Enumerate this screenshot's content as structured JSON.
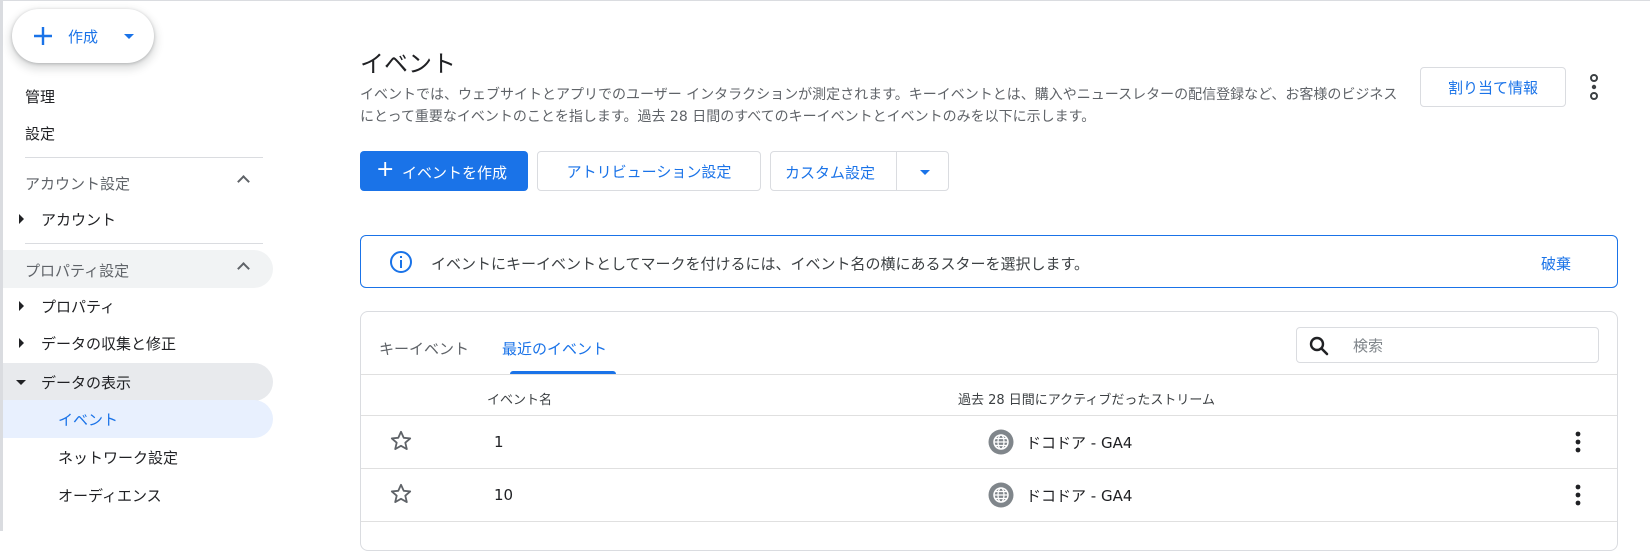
{
  "sidebar": {
    "create_label": "作成",
    "items": {
      "admin": "管理",
      "settings": "設定"
    },
    "account_section": "アカウント設定",
    "account_item": "アカウント",
    "property_section": "プロパティ設定",
    "property_item": "プロパティ",
    "data_collection": "データの収集と修正",
    "data_display": "データの表示",
    "events": "イベント",
    "network": "ネットワーク設定",
    "audience": "オーディエンス"
  },
  "page": {
    "title": "イベント",
    "description": "イベントでは、ウェブサイトとアプリでのユーザー インタラクションが測定されます。キーイベントとは、購入やニュースレターの配信登録など、お客様のビジネスにとって重要なイベントのことを指します。過去 28 日間のすべてのキーイベントとイベントのみを以下に示します。",
    "assign_button": "割り当て情報",
    "create_event_button": "イベントを作成",
    "attribution_button": "アトリビューション設定",
    "custom_button": "カスタム設定"
  },
  "banner": {
    "text": "イベントにキーイベントとしてマークを付けるには、イベント名の横にあるスターを選択します。",
    "dismiss": "破棄"
  },
  "table": {
    "tabs": [
      "キーイベント",
      "最近のイベント"
    ],
    "active_tab": "最近のイベント",
    "search_placeholder": "検索",
    "columns": [
      "イベント名",
      "過去 28 日間にアクティブだったストリーム"
    ],
    "rows": [
      {
        "name": "1",
        "stream": "ドコドア - GA4"
      },
      {
        "name": "10",
        "stream": "ドコドア - GA4"
      }
    ]
  },
  "colors": {
    "accent": "#1a73e8",
    "selected_bg": "#e8f0fe",
    "hover_bg": "#e8eaed"
  }
}
